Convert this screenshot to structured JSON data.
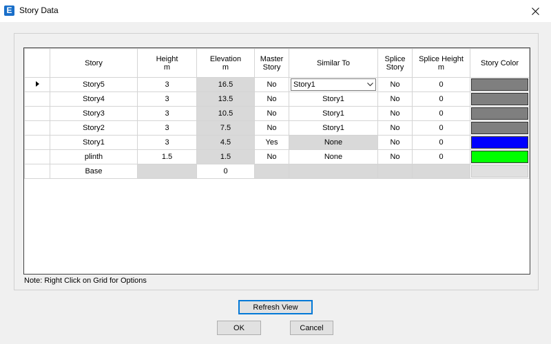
{
  "window": {
    "title": "Story Data",
    "app_icon_letter": "E"
  },
  "table": {
    "columns": [
      {
        "label": "Story",
        "unit": ""
      },
      {
        "label": "Height",
        "unit": "m"
      },
      {
        "label": "Elevation",
        "unit": "m"
      },
      {
        "label": "Master Story",
        "unit": ""
      },
      {
        "label": "Similar To",
        "unit": ""
      },
      {
        "label": "Splice Story",
        "unit": ""
      },
      {
        "label": "Splice Height",
        "unit": "m"
      },
      {
        "label": "Story Color",
        "unit": ""
      }
    ],
    "rows": [
      {
        "story": "Story5",
        "height": "3",
        "elevation": "16.5",
        "master": "No",
        "similar": "Story1",
        "splice": "No",
        "splice_height": "0",
        "color": "#7f7f7f",
        "current": true,
        "similar_dropdown": true
      },
      {
        "story": "Story4",
        "height": "3",
        "elevation": "13.5",
        "master": "No",
        "similar": "Story1",
        "splice": "No",
        "splice_height": "0",
        "color": "#7f7f7f"
      },
      {
        "story": "Story3",
        "height": "3",
        "elevation": "10.5",
        "master": "No",
        "similar": "Story1",
        "splice": "No",
        "splice_height": "0",
        "color": "#7f7f7f"
      },
      {
        "story": "Story2",
        "height": "3",
        "elevation": "7.5",
        "master": "No",
        "similar": "Story1",
        "splice": "No",
        "splice_height": "0",
        "color": "#7f7f7f"
      },
      {
        "story": "Story1",
        "height": "3",
        "elevation": "4.5",
        "master": "Yes",
        "similar": "None",
        "splice": "No",
        "splice_height": "0",
        "color": "#0000ff",
        "similar_gray": true
      },
      {
        "story": "plinth",
        "height": "1.5",
        "elevation": "1.5",
        "master": "No",
        "similar": "None",
        "splice": "No",
        "splice_height": "0",
        "color": "#00ff00"
      },
      {
        "story": "Base",
        "height": "",
        "elevation": "0",
        "master": "",
        "similar": "",
        "splice": "",
        "splice_height": "",
        "color": "#e0e0e0",
        "base": true
      }
    ]
  },
  "note": "Note:  Right Click on Grid for Options",
  "buttons": {
    "refresh": "Refresh View",
    "ok": "OK",
    "cancel": "Cancel"
  }
}
